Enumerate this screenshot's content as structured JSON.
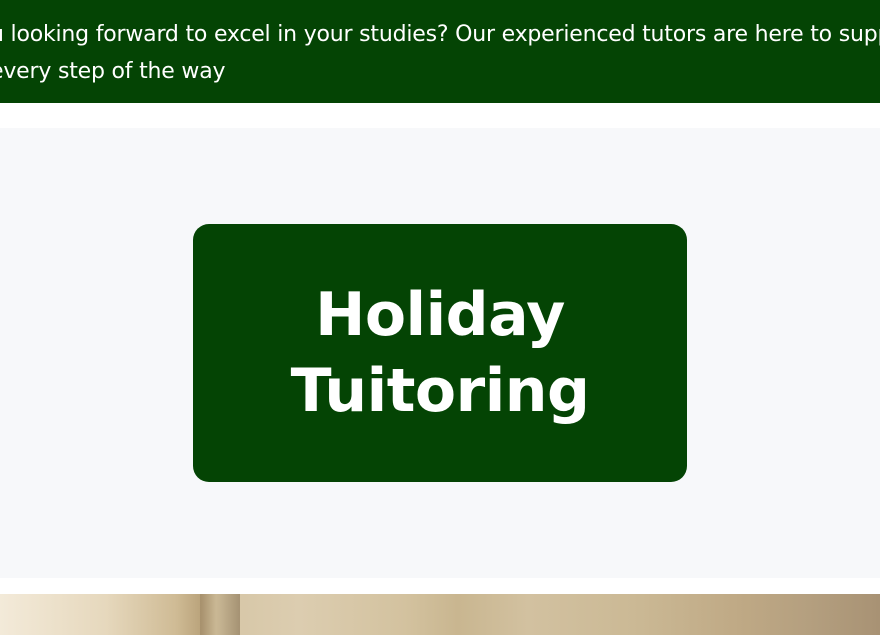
{
  "banner": {
    "text": "u looking forward to excel in your studies? Our experienced tutors are here to support you every step of the way",
    "background": "#044404",
    "text_color": "#ffffff"
  },
  "hero": {
    "title": "Holiday Tuitoring",
    "card_color": "#044404",
    "background": "#f7f8fa"
  },
  "photo": {
    "name": "hero-photo"
  }
}
